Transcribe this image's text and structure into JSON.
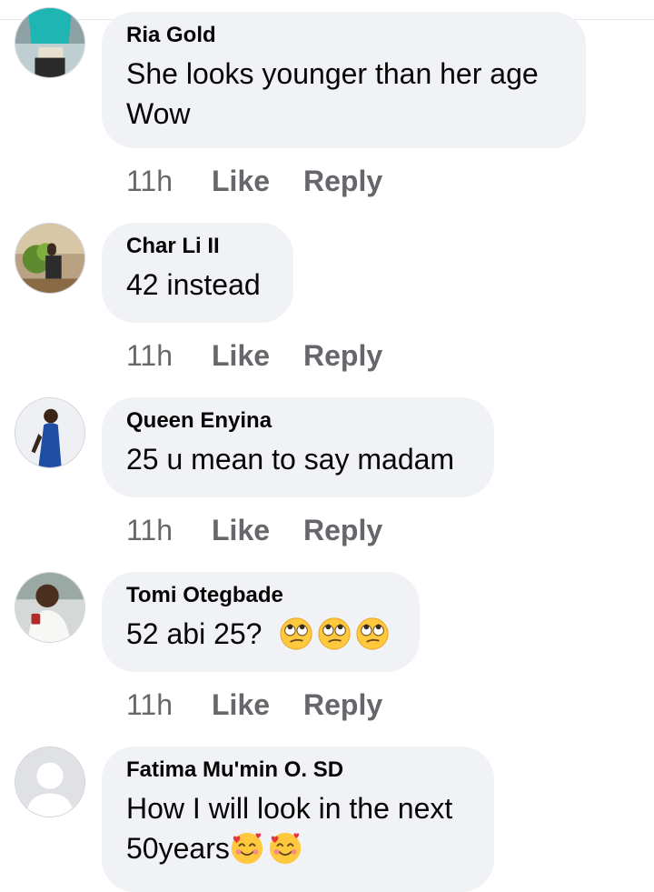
{
  "comments": [
    {
      "author": "Ria Gold",
      "text": "She looks younger than her age",
      "text2": "Wow",
      "time": "11h",
      "like": "Like",
      "reply": "Reply",
      "avatar": "avatar-photo-woman-teal"
    },
    {
      "author": "Char Li II",
      "text": "42 instead",
      "time": "11h",
      "like": "Like",
      "reply": "Reply",
      "avatar": "avatar-photo-outdoor"
    },
    {
      "author": "Queen Enyina",
      "text": "25 u mean to say madam",
      "time": "11h",
      "like": "Like",
      "reply": "Reply",
      "avatar": "avatar-photo-woman-blue-dress"
    },
    {
      "author": "Tomi Otegbade",
      "text": "52 abi 25?",
      "emojis": [
        "face-with-rolling-eyes",
        "face-with-rolling-eyes",
        "face-with-rolling-eyes"
      ],
      "time": "11h",
      "like": "Like",
      "reply": "Reply",
      "avatar": "avatar-photo-man-white-shirt"
    },
    {
      "author": "Fatima Mu'min O. SD",
      "text": "How I will look in the next",
      "text2": "50years",
      "emojis": [
        "smiling-face-with-hearts",
        "smiling-face-with-hearts"
      ],
      "avatar": "default-avatar-silhouette"
    }
  ],
  "colors": {
    "bubble": "#f0f2f5",
    "meta": "#65676b",
    "text": "#050505"
  }
}
